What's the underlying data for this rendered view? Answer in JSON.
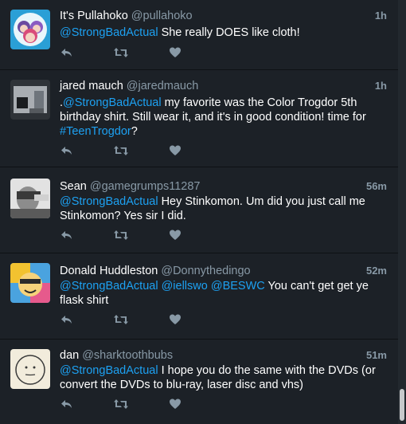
{
  "tweets": [
    {
      "name": "It's Pullahoko",
      "handle": "@pullahoko",
      "time": "1h",
      "parts": [
        {
          "text": "@StrongBadActual",
          "mention": true
        },
        {
          "text": " She really DOES like cloth!",
          "mention": false
        }
      ]
    },
    {
      "name": "jared mauch",
      "handle": "@jaredmauch",
      "time": "1h",
      "parts": [
        {
          "text": ".",
          "mention": false
        },
        {
          "text": "@StrongBadActual",
          "mention": true
        },
        {
          "text": " my favorite was the Color Trogdor 5th birthday shirt.  Still wear it, and it's in good condition!  time for ",
          "mention": false
        },
        {
          "text": "#TeenTrogdor",
          "mention": true
        },
        {
          "text": "?",
          "mention": false
        }
      ]
    },
    {
      "name": "Sean",
      "handle": "@gamegrumps11287",
      "time": "56m",
      "parts": [
        {
          "text": "@StrongBadActual",
          "mention": true
        },
        {
          "text": " Hey Stinkomon. Um did you just call me Stinkomon? Yes sir I did.",
          "mention": false
        }
      ]
    },
    {
      "name": "Donald Huddleston",
      "handle": "@Donnythedingo",
      "time": "52m",
      "parts": [
        {
          "text": "@StrongBadActual",
          "mention": true
        },
        {
          "text": " ",
          "mention": false
        },
        {
          "text": "@iellswo",
          "mention": true
        },
        {
          "text": "  ",
          "mention": false
        },
        {
          "text": "@BESWC",
          "mention": true
        },
        {
          "text": " You can't get get ye flask shirt",
          "mention": false
        }
      ]
    },
    {
      "name": "dan",
      "handle": "@sharktoothbubs",
      "time": "51m",
      "parts": [
        {
          "text": "@StrongBadActual",
          "mention": true
        },
        {
          "text": " I hope you do the same with the DVDs (or convert the DVDs to blu-ray, laser disc and vhs)",
          "mention": false
        }
      ]
    }
  ],
  "icons": {
    "reply": "reply-icon",
    "retweet": "retweet-icon",
    "like": "heart-icon"
  },
  "colors": {
    "background": "#1c2127",
    "mention": "#1da1f2",
    "muted": "#8899a6",
    "action_icon": "#8899a6"
  }
}
